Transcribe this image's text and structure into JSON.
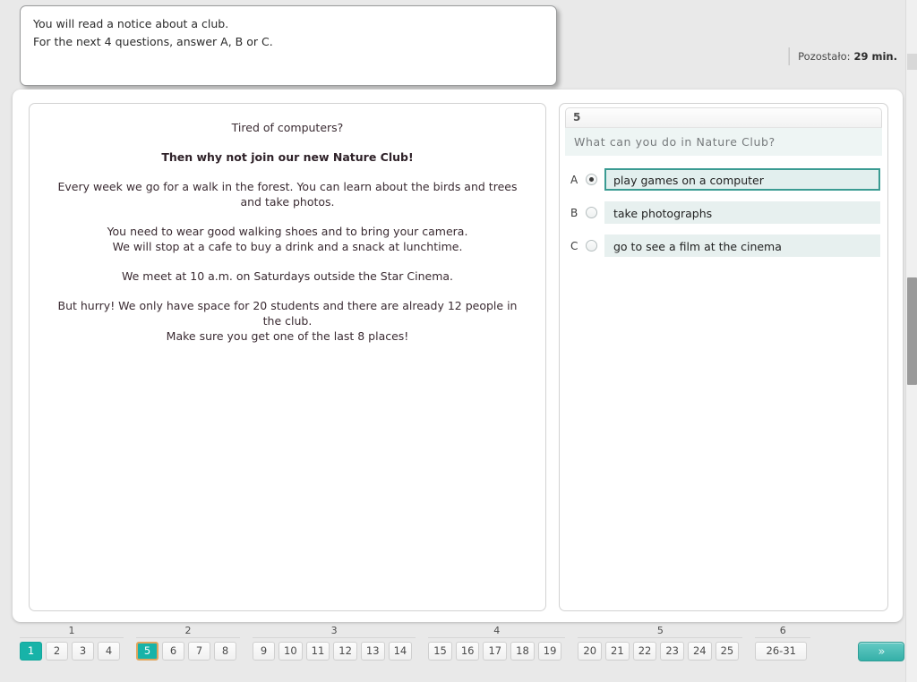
{
  "instructions": {
    "line1": "You will read a notice about a club.",
    "line2": "For the next 4 questions, answer A, B or C."
  },
  "timer": {
    "label": "Pozostało:",
    "value": "29 min."
  },
  "passage": {
    "paragraphs": [
      {
        "text": "Tired of computers?",
        "bold": false
      },
      {
        "text": "Then why not join our new Nature Club!",
        "bold": true
      },
      {
        "text": "Every week we go for a walk in the forest. You can learn about the birds and trees and take photos.",
        "bold": false
      },
      {
        "text": "You need to wear good walking shoes and to bring your camera.\nWe will stop at a cafe to buy a drink and a snack at lunchtime.",
        "bold": false
      },
      {
        "text": "We meet at 10 a.m. on Saturdays outside the Star Cinema.",
        "bold": false
      },
      {
        "text": "But hurry! We only have space for 20 students and there are already 12 people in the club.\nMake sure you get one of the last 8 places!",
        "bold": false
      }
    ]
  },
  "question": {
    "number": "5",
    "stem": "What can you do in Nature Club?",
    "options": [
      {
        "letter": "A",
        "text": "play games on a computer",
        "selected": true
      },
      {
        "letter": "B",
        "text": "take photographs",
        "selected": false
      },
      {
        "letter": "C",
        "text": "go to see a film at the cinema",
        "selected": false
      }
    ]
  },
  "navigation": {
    "groups": [
      {
        "label": "1",
        "buttons": [
          {
            "label": "1",
            "state": "answered"
          },
          {
            "label": "2",
            "state": "normal"
          },
          {
            "label": "3",
            "state": "normal"
          },
          {
            "label": "4",
            "state": "normal"
          }
        ]
      },
      {
        "label": "2",
        "buttons": [
          {
            "label": "5",
            "state": "current"
          },
          {
            "label": "6",
            "state": "normal"
          },
          {
            "label": "7",
            "state": "normal"
          },
          {
            "label": "8",
            "state": "normal"
          }
        ]
      },
      {
        "label": "3",
        "buttons": [
          {
            "label": "9",
            "state": "normal"
          },
          {
            "label": "10",
            "state": "normal"
          },
          {
            "label": "11",
            "state": "normal"
          },
          {
            "label": "12",
            "state": "normal"
          },
          {
            "label": "13",
            "state": "normal"
          },
          {
            "label": "14",
            "state": "normal"
          }
        ]
      },
      {
        "label": "4",
        "buttons": [
          {
            "label": "15",
            "state": "normal"
          },
          {
            "label": "16",
            "state": "normal"
          },
          {
            "label": "17",
            "state": "normal"
          },
          {
            "label": "18",
            "state": "normal"
          },
          {
            "label": "19",
            "state": "normal"
          }
        ]
      },
      {
        "label": "5",
        "buttons": [
          {
            "label": "20",
            "state": "normal"
          },
          {
            "label": "21",
            "state": "normal"
          },
          {
            "label": "22",
            "state": "normal"
          },
          {
            "label": "23",
            "state": "normal"
          },
          {
            "label": "24",
            "state": "normal"
          },
          {
            "label": "25",
            "state": "normal"
          }
        ]
      },
      {
        "label": "6",
        "buttons": [
          {
            "label": "26-31",
            "state": "normal",
            "wide": true
          }
        ]
      }
    ],
    "next_label": "»"
  },
  "colors": {
    "accent_teal": "#17b3a8",
    "current_border": "#e0a55e",
    "selected_option_border": "#3a9b92",
    "option_bg": "#e7f0ef",
    "page_bg": "#e9e9e9"
  }
}
